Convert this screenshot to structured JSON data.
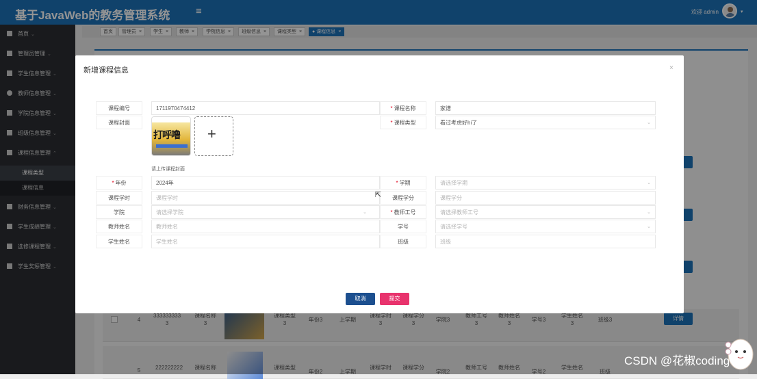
{
  "header": {
    "app_title": "基于JavaWeb的教务管理系统",
    "menu_icon": "hamburger-icon",
    "welcome_text": "欢迎 admin"
  },
  "sidebar": {
    "items": [
      {
        "label": "首页",
        "icon": "home-icon"
      },
      {
        "label": "管理员管理",
        "icon": "table-icon"
      },
      {
        "label": "学生信息管理",
        "icon": "grid-icon"
      },
      {
        "label": "教师信息管理",
        "icon": "user-icon"
      },
      {
        "label": "学院信息管理",
        "icon": "grid-icon"
      },
      {
        "label": "班级信息管理",
        "icon": "table-icon"
      },
      {
        "label": "课程信息管理",
        "icon": "doc-icon"
      },
      {
        "label": "财务信息管理",
        "icon": "grid-icon"
      },
      {
        "label": "学生成绩管理",
        "icon": "chart-icon"
      },
      {
        "label": "选修课程管理",
        "icon": "grid-icon"
      },
      {
        "label": "学生奖惩管理",
        "icon": "doc-icon"
      }
    ],
    "subitems": [
      {
        "label": "课程类型"
      },
      {
        "label": "课程信息"
      }
    ]
  },
  "tabs": [
    {
      "label": "首页"
    },
    {
      "label": "管理员"
    },
    {
      "label": "学生"
    },
    {
      "label": "教师"
    },
    {
      "label": "学院信息"
    },
    {
      "label": "班级信息"
    },
    {
      "label": "课程类型"
    },
    {
      "label": "课程信息"
    }
  ],
  "background_table": {
    "rows": [
      {
        "index": "4",
        "code": "333333333\n3",
        "name": "课程名称\n3",
        "type": "课程类型\n3",
        "year": "年份3",
        "term": "上学期",
        "hours": "课程学时\n3",
        "credit": "课程学分\n3",
        "college": "学院3",
        "teacher_no": "教师工号\n3",
        "teacher_name": "教师姓名\n3",
        "student_no": "学号3",
        "student_name": "学生姓名\n3",
        "class": "班级3",
        "action": "详情"
      },
      {
        "index": "5",
        "code": "222222222",
        "name": "课程名称",
        "type": "课程类型",
        "year": "年份2",
        "term": "上学期",
        "hours": "课程学时",
        "credit": "课程学分",
        "college": "学院2",
        "teacher_no": "教师工号",
        "teacher_name": "教师姓名",
        "student_no": "学号2",
        "student_name": "学生姓名",
        "class": "班级"
      }
    ]
  },
  "dialog": {
    "title": "新增课程信息",
    "close_icon": "close-icon",
    "fields": {
      "course_no": {
        "label": "课程编号",
        "value": "1711970474412"
      },
      "course_name": {
        "label": "课程名称",
        "value": "家谱"
      },
      "course_cover": {
        "label": "课程封面"
      },
      "course_type": {
        "label": "课程类型",
        "value": "看过考虑好hi了"
      },
      "year": {
        "label": "年份",
        "value": "2024年"
      },
      "term": {
        "label": "学期",
        "placeholder": "请选择学期"
      },
      "course_hours": {
        "label": "课程学时",
        "placeholder": "课程学时"
      },
      "course_credit": {
        "label": "课程学分",
        "placeholder": "课程学分"
      },
      "college": {
        "label": "学院",
        "placeholder": "请选择学院"
      },
      "teacher_no": {
        "label": "教师工号",
        "placeholder": "请选择教师工号"
      },
      "teacher_name": {
        "label": "教师姓名",
        "placeholder": "教师姓名"
      },
      "student_no": {
        "label": "学号",
        "placeholder": "请选择学号"
      },
      "student_name": {
        "label": "学生姓名",
        "placeholder": "学生姓名"
      },
      "class": {
        "label": "班级",
        "placeholder": "班级"
      }
    },
    "cover_image_text": "打呼噜",
    "upload_plus": "+",
    "upload_hint": "请上传课程封面",
    "cancel_label": "取消",
    "submit_label": "提交"
  },
  "watermark": "CSDN @花椒coding",
  "colors": {
    "primary": "#1c72b8",
    "sidebar": "#2b2e33",
    "required": "#e0001a",
    "cancel": "#1c4f8f",
    "submit": "#e8336d"
  }
}
